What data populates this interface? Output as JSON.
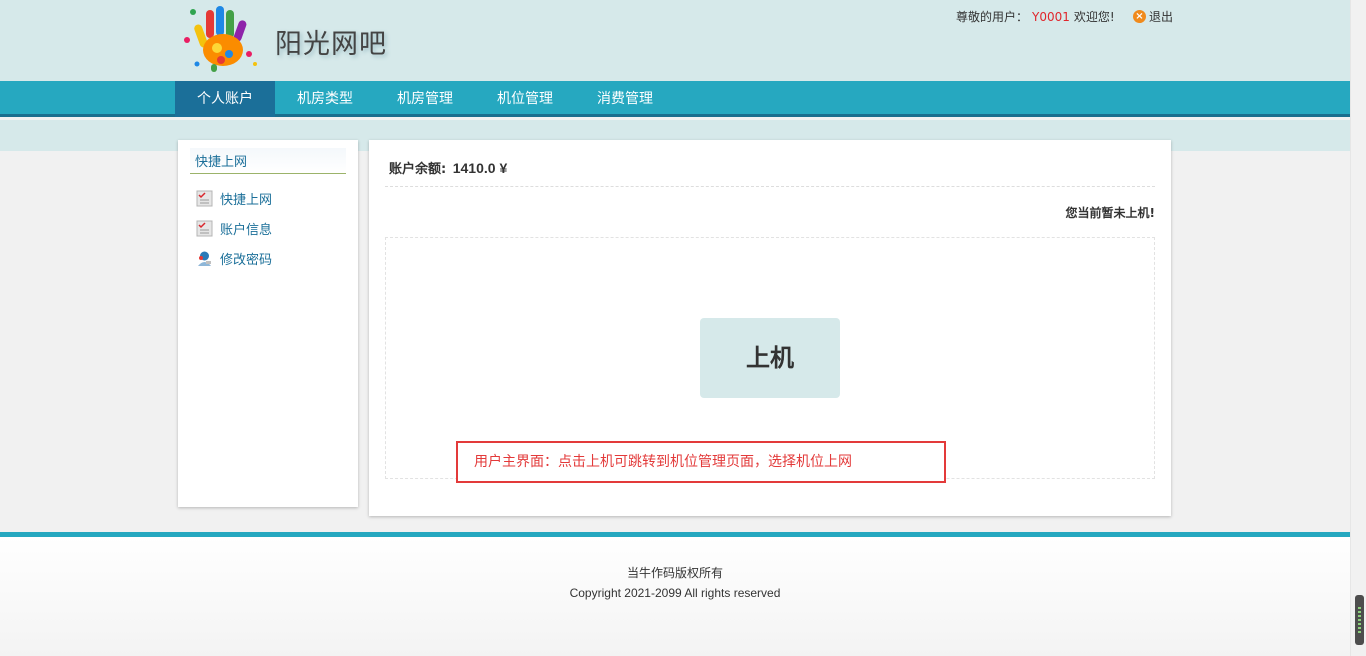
{
  "header": {
    "site_name": "阳光网吧",
    "greeting_prefix": "尊敬的用户：",
    "user_id": "Y0001",
    "greeting_suffix": "欢迎您!",
    "logout_label": "退出"
  },
  "nav": {
    "items": [
      {
        "label": "个人账户",
        "active": true
      },
      {
        "label": "机房类型"
      },
      {
        "label": "机房管理"
      },
      {
        "label": "机位管理"
      },
      {
        "label": "消费管理"
      }
    ]
  },
  "sidebar": {
    "title": "快捷上网",
    "items": [
      {
        "label": "快捷上网",
        "icon": "document-check-icon"
      },
      {
        "label": "账户信息",
        "icon": "document-check-icon"
      },
      {
        "label": "修改密码",
        "icon": "user-key-icon"
      }
    ]
  },
  "main": {
    "balance_label": "账户余额:",
    "balance_value": "1410.0 ¥",
    "status_message": "您当前暂未上机!",
    "go_online_label": "上机"
  },
  "annotation": "用户主界面：点击上机可跳转到机位管理页面，选择机位上网",
  "footer": {
    "line1": "当牛作码版权所有",
    "line2": "Copyright 2021-2099 All rights reserved"
  },
  "colors": {
    "header_bg": "#d6e9ea",
    "nav_bg": "#26a8c0",
    "nav_active": "#1b6f99",
    "accent_red": "#e33a3a"
  }
}
